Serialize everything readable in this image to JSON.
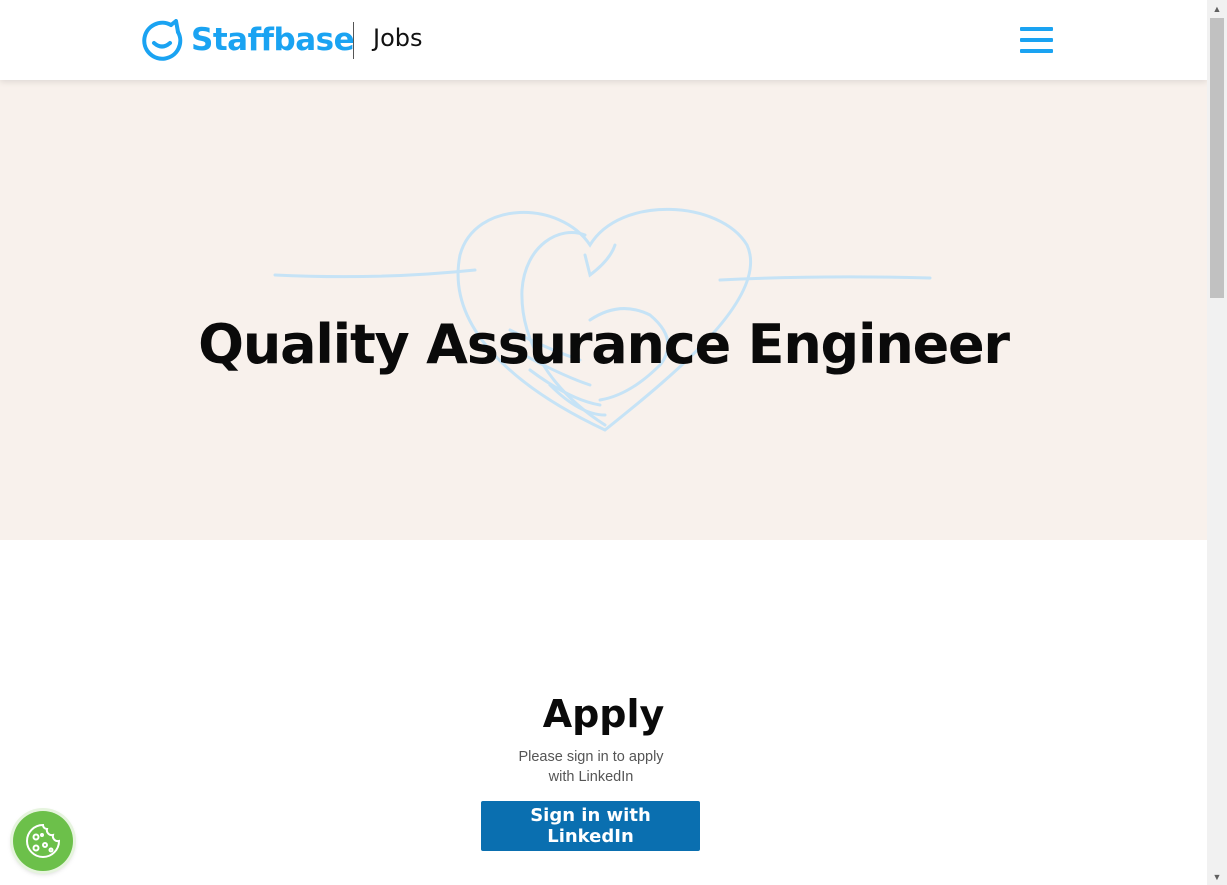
{
  "header": {
    "logo_text": "Staffbase",
    "section_label": "Jobs",
    "menu_icon": "hamburger-menu-icon",
    "logo_icon": "staffbase-logo-icon"
  },
  "hero": {
    "title": "Quality Assurance Engineer",
    "illustration": "heart-handshake-line-art"
  },
  "apply": {
    "title": "Apply",
    "note_line1": "Please sign in to apply",
    "note_line2": "with LinkedIn",
    "button_label": "Sign in with LinkedIn"
  },
  "cookie": {
    "icon": "cookie-icon"
  },
  "colors": {
    "brand": "#1aa3f2",
    "hero_bg": "#f8f1ec",
    "linkedin": "#0a6fb0",
    "cookie": "#6cc04a"
  }
}
